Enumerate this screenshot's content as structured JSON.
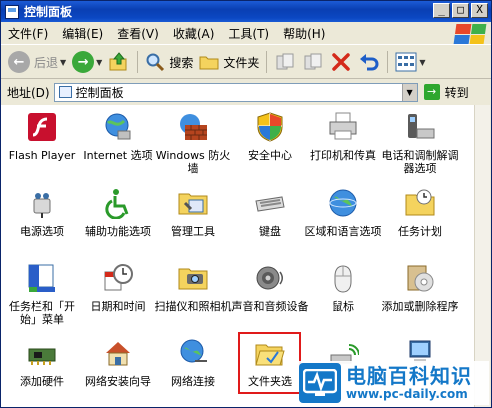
{
  "window": {
    "title": "控制面板"
  },
  "title_buttons": {
    "minimize": "_",
    "maximize": "□",
    "close": "X"
  },
  "menubar": {
    "items": [
      "文件(F)",
      "编辑(E)",
      "查看(V)",
      "收藏(A)",
      "工具(T)",
      "帮助(H)"
    ]
  },
  "toolbar": {
    "back": "后退",
    "search": "搜索",
    "folders": "文件夹"
  },
  "address": {
    "label": "地址(D)",
    "value": "控制面板",
    "go": "转到"
  },
  "items": [
    {
      "label": "Flash Player",
      "icon": "flash-player-icon"
    },
    {
      "label": "Internet 选项",
      "icon": "internet-options-icon"
    },
    {
      "label": "Windows 防火墙",
      "icon": "firewall-icon"
    },
    {
      "label": "安全中心",
      "icon": "security-center-icon"
    },
    {
      "label": "打印机和传真",
      "icon": "printers-faxes-icon"
    },
    {
      "label": "电话和调制解调器选项",
      "icon": "phone-modem-icon"
    },
    {
      "label": "电源选项",
      "icon": "power-options-icon"
    },
    {
      "label": "辅助功能选项",
      "icon": "accessibility-icon"
    },
    {
      "label": "管理工具",
      "icon": "admin-tools-icon"
    },
    {
      "label": "键盘",
      "icon": "keyboard-icon"
    },
    {
      "label": "区域和语言选项",
      "icon": "region-language-icon"
    },
    {
      "label": "任务计划",
      "icon": "scheduled-tasks-icon"
    },
    {
      "label": "任务栏和「开始」菜单",
      "icon": "taskbar-start-icon"
    },
    {
      "label": "日期和时间",
      "icon": "date-time-icon"
    },
    {
      "label": "扫描仪和照相机",
      "icon": "scanner-camera-icon"
    },
    {
      "label": "声音和音频设备",
      "icon": "sound-audio-icon"
    },
    {
      "label": "鼠标",
      "icon": "mouse-icon"
    },
    {
      "label": "添加或删除程序",
      "icon": "add-remove-programs-icon"
    },
    {
      "label": "添加硬件",
      "icon": "add-hardware-icon"
    },
    {
      "label": "网络安装向导",
      "icon": "network-setup-icon"
    },
    {
      "label": "网络连接",
      "icon": "network-connections-icon"
    },
    {
      "label": "文件夹选",
      "icon": "folder-options-icon"
    },
    {
      "label": "",
      "icon": "wireless-icon"
    },
    {
      "label": "",
      "icon": "system-icon"
    }
  ],
  "watermark": {
    "title": "电脑百科知识",
    "url": "www.pc-daily.com"
  },
  "colors": {
    "titlebar": "#0a3fb3",
    "highlight": "#e01a1a",
    "watermark": "#1478c8"
  }
}
